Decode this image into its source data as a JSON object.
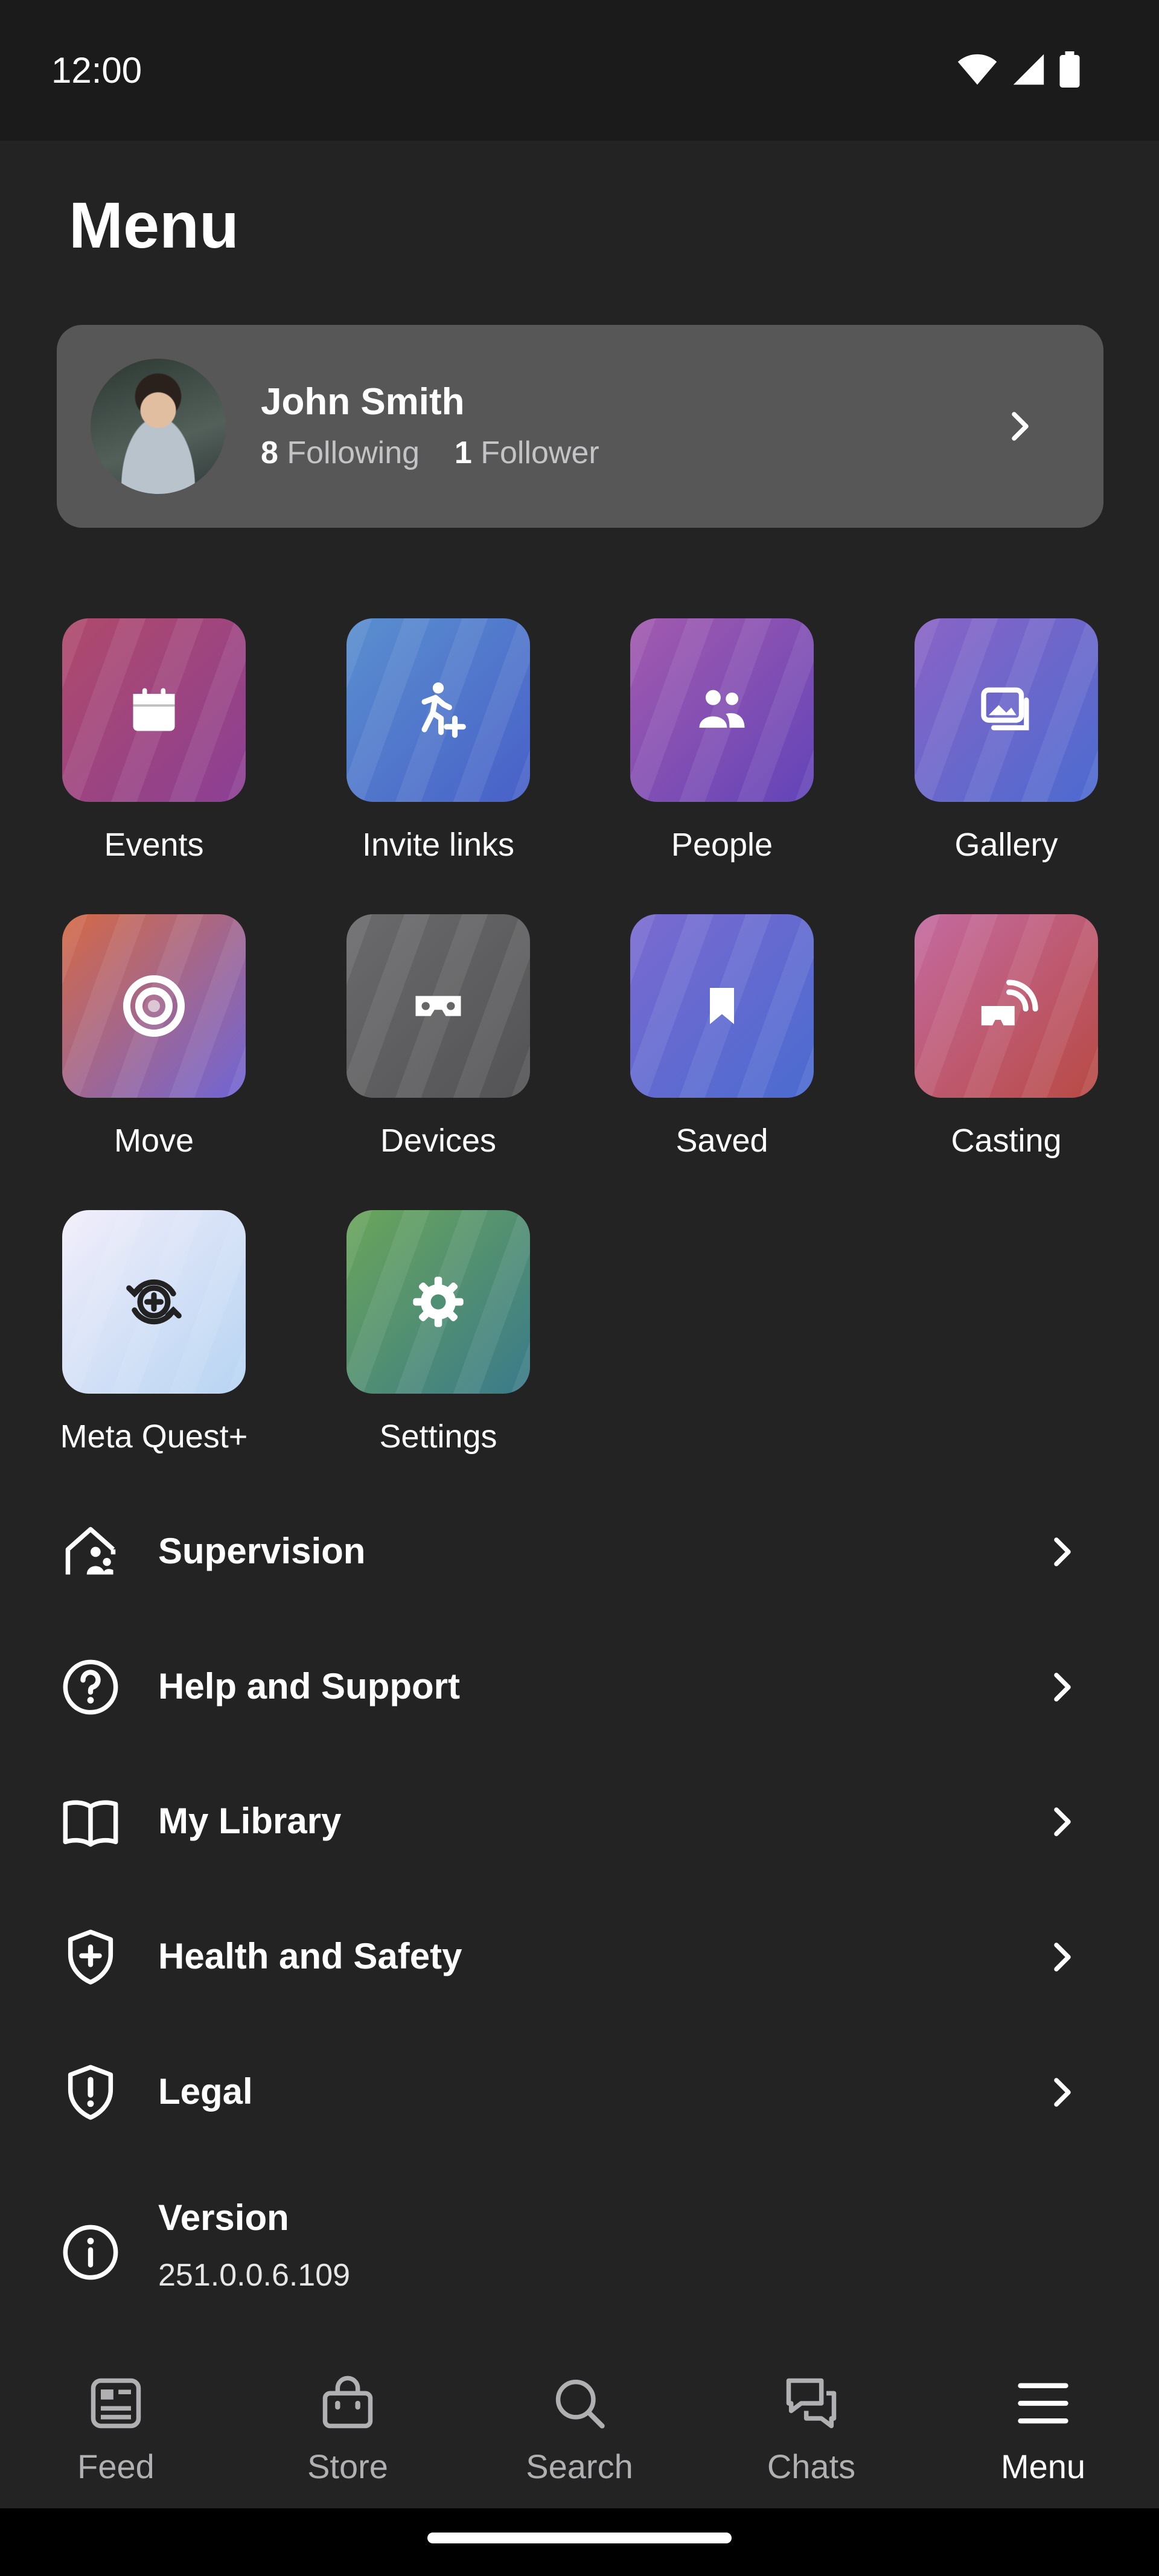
{
  "status_bar": {
    "time": "12:00"
  },
  "page_title": "Menu",
  "profile": {
    "name": "John Smith",
    "following_count": "8",
    "following_label": "Following",
    "follower_count": "1",
    "follower_label": "Follower"
  },
  "tiles": [
    {
      "label": "Events",
      "icon": "calendar-icon",
      "colors": [
        "#b04a6a",
        "#8b3f95"
      ]
    },
    {
      "label": "Invite links",
      "icon": "person-add-icon",
      "colors": [
        "#5a8fcf",
        "#4860c8"
      ]
    },
    {
      "label": "People",
      "icon": "people-icon",
      "colors": [
        "#a35aae",
        "#6244b8"
      ]
    },
    {
      "label": "Gallery",
      "icon": "gallery-icon",
      "colors": [
        "#8a63c6",
        "#4c6bd0"
      ]
    },
    {
      "label": "Move",
      "icon": "move-ring-icon",
      "colors": [
        "#d56945",
        "#7065d6"
      ]
    },
    {
      "label": "Devices",
      "icon": "headset-icon",
      "colors": [
        "#6a6a6c",
        "#535355"
      ]
    },
    {
      "label": "Saved",
      "icon": "bookmark-icon",
      "colors": [
        "#7b6ad0",
        "#4a6bd0"
      ]
    },
    {
      "label": "Casting",
      "icon": "cast-icon",
      "colors": [
        "#c46aa0",
        "#b84a44"
      ]
    },
    {
      "label": "Meta Quest+",
      "icon": "quest-plus-icon",
      "colors": [
        "#f2eefb",
        "#b7d4f2"
      ]
    },
    {
      "label": "Settings",
      "icon": "gear-icon",
      "colors": [
        "#6aa55a",
        "#3a7a8a"
      ]
    }
  ],
  "list": [
    {
      "label": "Supervision",
      "icon": "supervision-icon"
    },
    {
      "label": "Help and Support",
      "icon": "help-icon"
    },
    {
      "label": "My Library",
      "icon": "book-icon"
    },
    {
      "label": "Health and Safety",
      "icon": "shield-plus-icon"
    },
    {
      "label": "Legal",
      "icon": "shield-alert-icon"
    }
  ],
  "version": {
    "label": "Version",
    "value": "251.0.0.6.109",
    "icon": "info-icon"
  },
  "bottom_nav": [
    {
      "label": "Feed",
      "icon": "feed-icon"
    },
    {
      "label": "Store",
      "icon": "store-icon"
    },
    {
      "label": "Search",
      "icon": "search-icon"
    },
    {
      "label": "Chats",
      "icon": "chats-icon"
    },
    {
      "label": "Menu",
      "icon": "menu-icon",
      "active": true
    }
  ]
}
